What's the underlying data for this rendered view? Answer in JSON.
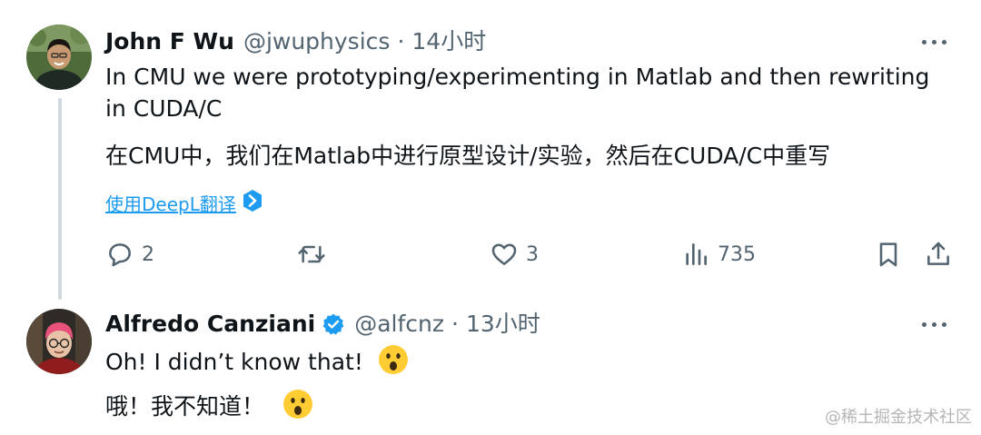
{
  "tweets": [
    {
      "author_name": "John F Wu",
      "handle": "@jwuphysics",
      "separator": "·",
      "time": "14小时",
      "text": "In CMU we were prototyping/experimenting in Matlab and then rewriting in CUDA/C",
      "translation": "在CMU中，我们在Matlab中进行原型设计/实验，然后在CUDA/C中重写",
      "translate_link": "使用DeepL翻译",
      "replies": "2",
      "likes": "3",
      "views": "735"
    },
    {
      "author_name": "Alfredo Canziani",
      "handle": "@alfcnz",
      "separator": "·",
      "time": "13小时",
      "text": "Oh! I didn’t know that!",
      "translation": "哦！我不知道！",
      "verified": true
    }
  ],
  "icons": {
    "reply": "reply-icon",
    "retweet": "retweet-icon",
    "like": "heart-icon",
    "views": "views-icon",
    "bookmark": "bookmark-icon",
    "share": "share-icon",
    "more": "more-icon",
    "verified": "verified-badge-icon",
    "deepl": "deepl-icon",
    "emoji": "surprised-face-emoji"
  },
  "colors": {
    "accent": "#1d9bf0",
    "secondary_text": "#536471",
    "primary_text": "#0f1419",
    "thread_line": "#cfd9de"
  },
  "watermark": "@稀土掘金技术社区"
}
